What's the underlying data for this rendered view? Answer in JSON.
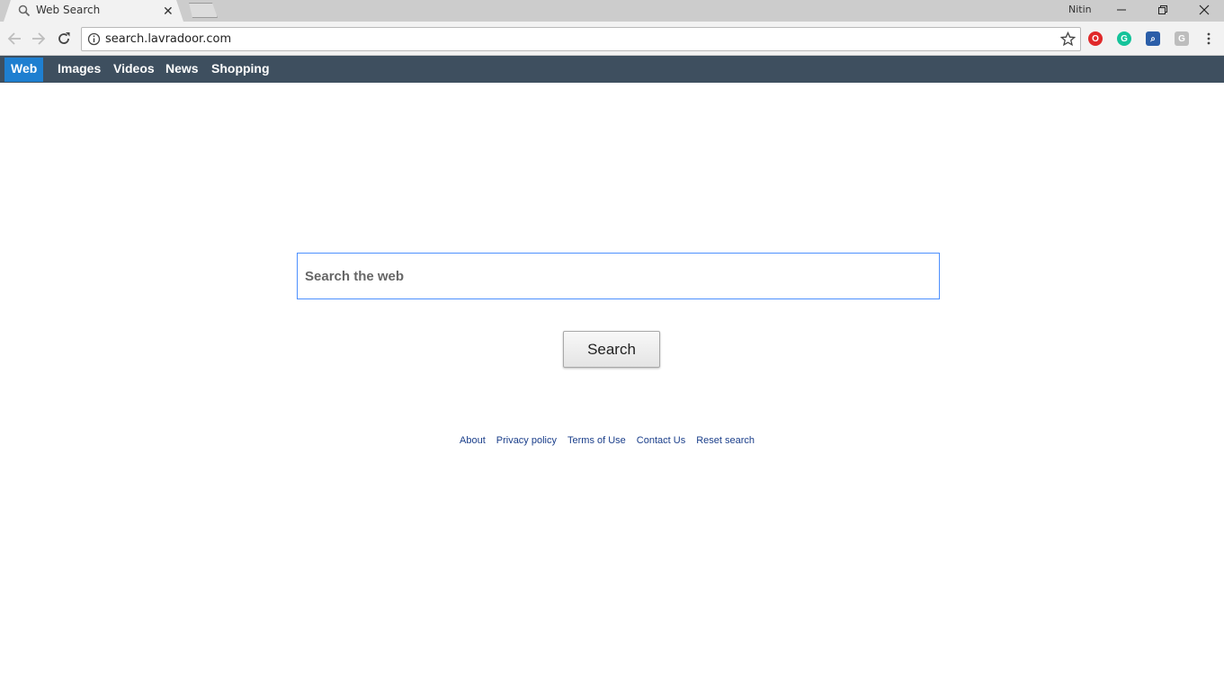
{
  "browser": {
    "tab_title": "Web Search",
    "tab_close": "✕",
    "profile_name": "Nitin",
    "url": "search.lavradoor.com",
    "extensions": [
      {
        "name": "opera-icon",
        "color": "#e0292a",
        "glyph": "O"
      },
      {
        "name": "grammarly-icon",
        "color": "#15c39a",
        "glyph": "G"
      },
      {
        "name": "search-extension-icon",
        "color": "#2b5ea8",
        "glyph": "⌕"
      },
      {
        "name": "g-extension-icon",
        "color": "#bdbdbd",
        "glyph": "G"
      }
    ]
  },
  "site_nav": {
    "items": [
      {
        "label": "Web",
        "active": true
      },
      {
        "label": "Images",
        "active": false
      },
      {
        "label": "Videos",
        "active": false
      },
      {
        "label": "News",
        "active": false
      },
      {
        "label": "Shopping",
        "active": false
      }
    ]
  },
  "search": {
    "placeholder": "Search the web",
    "button_label": "Search"
  },
  "footer": {
    "links": [
      "About",
      "Privacy policy",
      "Terms of Use",
      "Contact Us",
      "Reset search"
    ]
  },
  "colors": {
    "nav_bar": "#3e4f5f",
    "nav_active": "#1e7fd0",
    "link": "#1a3e8a",
    "input_border": "#4d90fe"
  }
}
